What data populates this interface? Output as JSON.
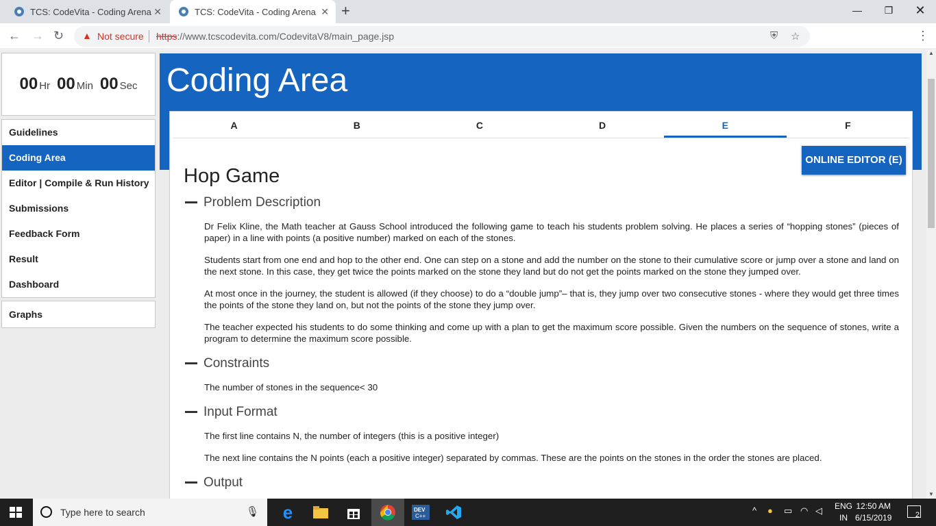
{
  "browser": {
    "tabs": [
      {
        "title": "TCS: CodeVita - Coding Arena"
      },
      {
        "title": "TCS: CodeVita - Coding Arena"
      }
    ],
    "security": "Not secure",
    "url_scheme": "https",
    "url_rest": "://www.tcscodevita.com/CodevitaV8/main_page.jsp"
  },
  "timer": {
    "hours": "00",
    "hr_label": "Hr",
    "minutes": "00",
    "min_label": "Min",
    "seconds": "00",
    "sec_label": "Sec"
  },
  "sidebar": {
    "items": [
      {
        "label": "Guidelines",
        "active": false
      },
      {
        "label": "Coding Area",
        "active": true
      },
      {
        "label": "Editor | Compile & Run History",
        "active": false
      },
      {
        "label": "Submissions",
        "active": false
      },
      {
        "label": "Feedback Form",
        "active": false
      },
      {
        "label": "Result",
        "active": false
      },
      {
        "label": "Dashboard",
        "active": false
      }
    ],
    "graphs_label": "Graphs"
  },
  "main": {
    "title": "Coding Area",
    "question_tabs": [
      "A",
      "B",
      "C",
      "D",
      "E",
      "F"
    ],
    "active_tab": "E",
    "editor_button": "ONLINE EDITOR (E)",
    "problem_title": "Hop Game",
    "sections": {
      "description_heading": "Problem Description",
      "description": [
        "Dr Felix Kline, the Math teacher at Gauss School introduced the following game to teach his students problem solving. He places a series of “hopping stones” (pieces of paper) in a line with points (a positive number) marked on each of the stones.",
        "Students start from one end and hop to the other end. One can step on a stone and add the number on the stone to their cumulative score or jump over a stone and land on the next stone. In this case, they get twice the points marked on the stone they land but do not get the points marked on the stone they jumped over.",
        "At most once in the journey, the student is allowed (if they choose) to do a “double jump”– that is, they jump over two consecutive stones - where they would get three times the points of the stone they land on, but not the points of the stone they jump over.",
        "The teacher expected his students to do some thinking and come up with a plan to get the maximum score possible. Given the numbers on the sequence of stones, write a program to determine the maximum score possible."
      ],
      "constraints_heading": "Constraints",
      "constraints": "The number of stones in the sequence< 30",
      "input_heading": "Input Format",
      "input": [
        "The first line contains N, the number of integers (this is a positive integer)",
        "The next line contains the N points (each a positive integer) separated by commas. These are the points on the stones in the order the stones are placed."
      ],
      "output_heading": "Output"
    }
  },
  "taskbar": {
    "search_placeholder": "Type here to search",
    "lang_top": "ENG",
    "lang_bottom": "IN",
    "time": "12:50 AM",
    "date": "6/15/2019",
    "notifications": "2"
  },
  "colors": {
    "primary": "#1565c0",
    "background": "#ececec"
  },
  "icons": [
    "codevita-favicon",
    "close-icon",
    "new-tab-icon",
    "minimize-icon",
    "restore-icon",
    "window-close-icon",
    "back-icon",
    "forward-icon",
    "reload-icon",
    "warning-icon",
    "shield-icon",
    "star-icon",
    "windows-start-icon",
    "search-icon",
    "mic-icon",
    "edge-icon",
    "folder-icon",
    "store-icon",
    "chrome-icon",
    "devcpp-icon",
    "vscode-icon"
  ]
}
